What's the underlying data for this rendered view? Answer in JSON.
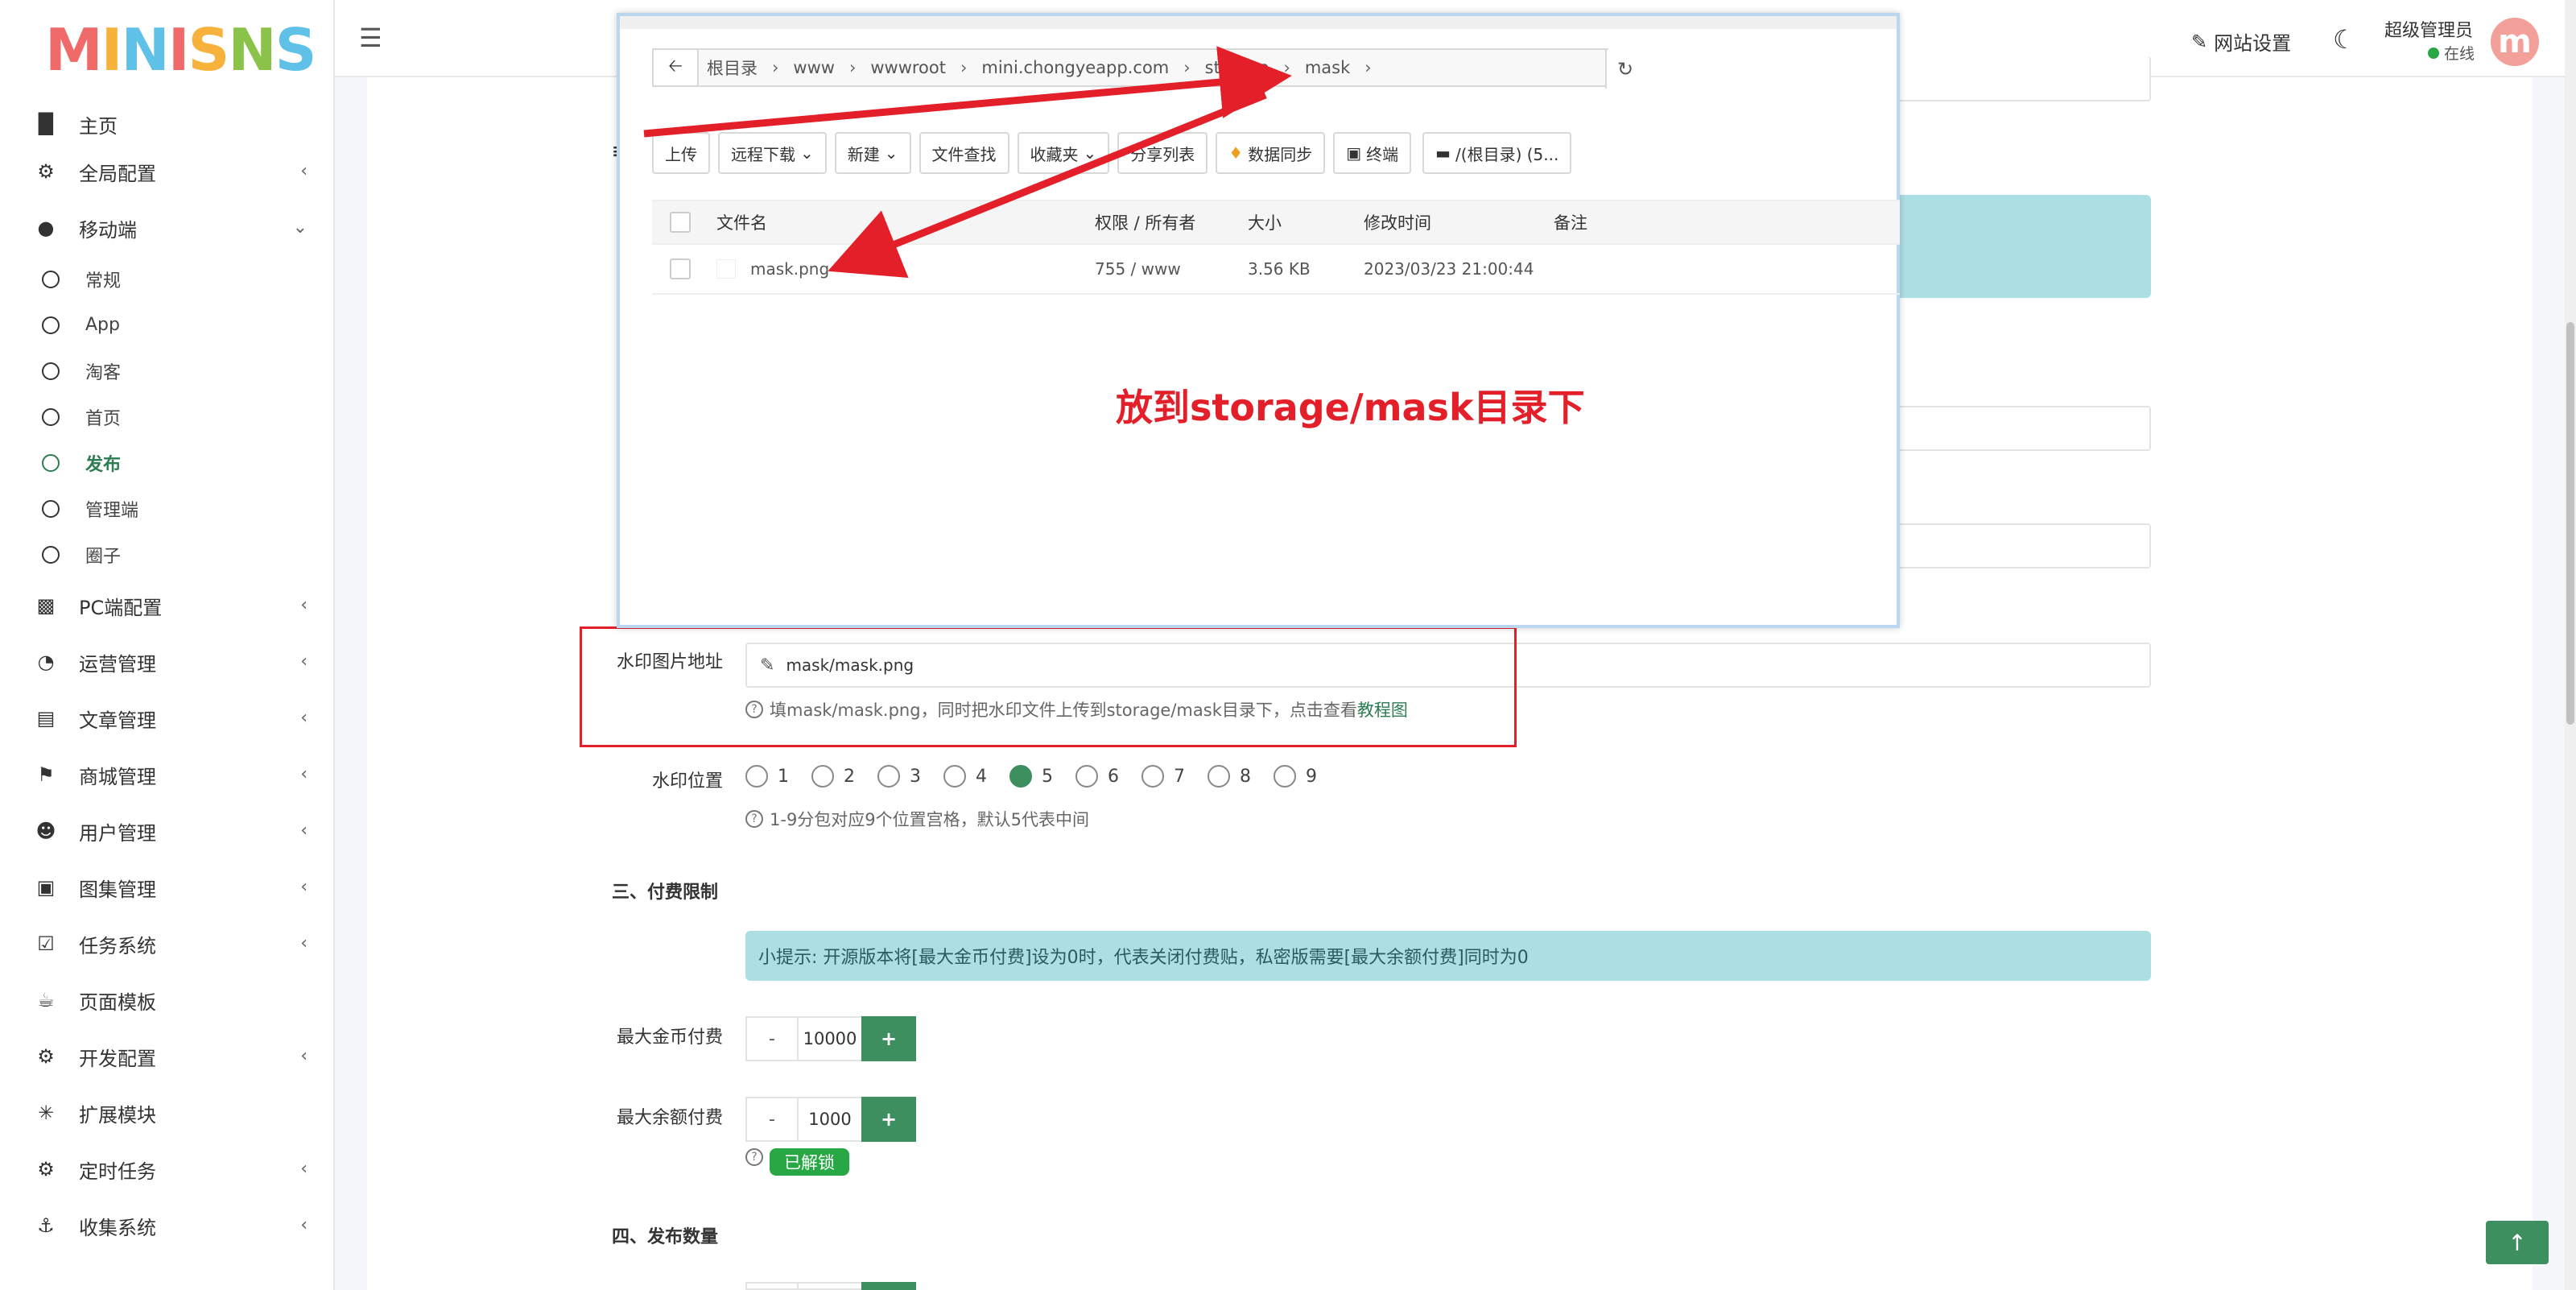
{
  "sidebar": {
    "logo": "MINISNS",
    "items": [
      {
        "label": "主页",
        "icon": "bar-chart-icon"
      },
      {
        "label": "全局配置",
        "icon": "gear-icon"
      },
      {
        "label": "移动端",
        "icon": "wechat-icon"
      },
      {
        "label": "PC端配置",
        "icon": "vr-icon"
      },
      {
        "label": "运营管理",
        "icon": "pie-chart-icon"
      },
      {
        "label": "文章管理",
        "icon": "book-icon"
      },
      {
        "label": "商城管理",
        "icon": "cart-icon"
      },
      {
        "label": "用户管理",
        "icon": "users-icon"
      },
      {
        "label": "图集管理",
        "icon": "image-icon"
      },
      {
        "label": "任务系统",
        "icon": "check-square-icon"
      },
      {
        "label": "页面模板",
        "icon": "coffee-icon"
      },
      {
        "label": "开发配置",
        "icon": "cog-icon"
      },
      {
        "label": "扩展模块",
        "icon": "badge-icon"
      },
      {
        "label": "定时任务",
        "icon": "cogs-icon"
      },
      {
        "label": "收集系统",
        "icon": "anchor-icon"
      }
    ],
    "sub_items": [
      "常规",
      "App",
      "淘客",
      "首页",
      "发布",
      "管理端",
      "圈子"
    ],
    "active_sub": "发布"
  },
  "topbar": {
    "site_settings": "网站设置",
    "user_name": "超级管理员",
    "user_status": "在线",
    "avatar_letter": "m"
  },
  "file_manager": {
    "crumbs": [
      "根目录",
      "www",
      "wwwroot",
      "mini.chongyeapp.com",
      "storage",
      "mask"
    ],
    "toolbar": [
      "上传",
      "远程下载",
      "新建",
      "文件查找",
      "收藏夹",
      "分享列表",
      "数据同步",
      "终端",
      "/(根目录) (5..."
    ],
    "columns": [
      "文件名",
      "权限 / 所有者",
      "大小",
      "修改时间",
      "备注"
    ],
    "rows": [
      {
        "name": "mask.png",
        "perm": "755 / www",
        "size": "3.56 KB",
        "time": "2023/03/23 21:00:44",
        "note": ""
      }
    ],
    "annotation": "放到storage/mask目录下"
  },
  "form": {
    "watermark_label": "水印图片地址",
    "watermark_value": "mask/mask.png",
    "watermark_hint": "填mask/mask.png，同时把水印文件上传到storage/mask目录下，点击查看",
    "watermark_hint_link": "教程图",
    "position_label": "水印位置",
    "positions": [
      "1",
      "2",
      "3",
      "4",
      "5",
      "6",
      "7",
      "8",
      "9"
    ],
    "position_selected": "5",
    "position_hint": "1-9分包对应9个位置宫格，默认5代表中间",
    "section3": "三、付费限制",
    "tip": "小提示: 开源版本将[最大金币付费]设为0时，代表关闭付费贴，私密版需要[最大余额付费]同时为0",
    "max_coin_label": "最大金币付费",
    "max_coin_value": "10000",
    "max_balance_label": "最大余额付费",
    "max_balance_value": "1000",
    "unlocked": "已解锁",
    "section4": "四、发布数量",
    "minus": "-",
    "plus": "+"
  },
  "colors": {
    "accent": "#3d8f5f",
    "annotation": "#e3202a",
    "tip_bg": "#acdfe4"
  }
}
